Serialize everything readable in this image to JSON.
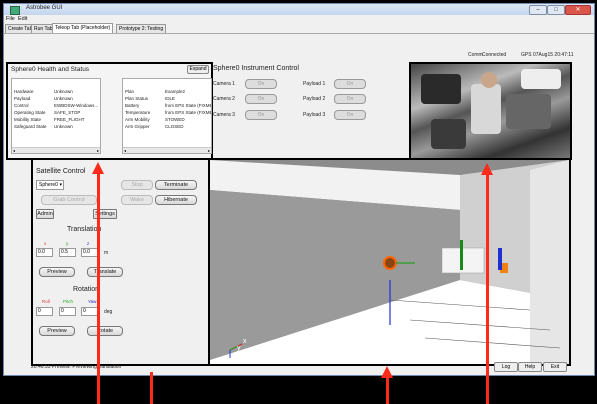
{
  "window": {
    "title": "Astrobee GUI",
    "minimize": "–",
    "maximize": "□",
    "close": "✕"
  },
  "menu": [
    "File",
    "Edit"
  ],
  "tabs": [
    "Create Tab",
    "Run Tab",
    "Teleop Tab (Placeholder)",
    "Prototype 2: Testing"
  ],
  "comm": {
    "label": "Comm",
    "value": "Connected",
    "gps_label": "GPS",
    "gps_value": "07Aug15 20:47:11"
  },
  "health": {
    "title": "Sphere0 Health and Status",
    "expand": "Expand",
    "left_rows": [
      {
        "k": "Hardware",
        "v": "Unknown"
      },
      {
        "k": "Payload",
        "v": "Unknown"
      },
      {
        "k": "Control",
        "v": "EWBDSW-Windows..."
      },
      {
        "k": "Operating State",
        "v": "SAFE_STOP"
      },
      {
        "k": "Mobility State",
        "v": "FREE_FLIGHT"
      },
      {
        "k": "Safeguard State",
        "v": "Unknown"
      }
    ],
    "right_rows": [
      {
        "k": "Plan",
        "v": "Example2"
      },
      {
        "k": "Plan Status",
        "v": "IDLE"
      },
      {
        "k": "Battery",
        "v": "from EPS State (FIXME)"
      },
      {
        "k": "Temperature",
        "v": "from EPS State (FIXME)"
      },
      {
        "k": "Arm Mobility",
        "v": "STOWED"
      },
      {
        "k": "Arm Gripper",
        "v": "CLOSED"
      }
    ],
    "scroll_glyphs": {
      "left": "◂",
      "right": "▸"
    }
  },
  "instrument": {
    "title": "Sphere0 Instrument Control",
    "cameras": [
      "Camera 1",
      "Camera 2",
      "Camera 3"
    ],
    "payloads": [
      "Payload 1",
      "Payload 2",
      "Payload 3"
    ],
    "on_label": "On"
  },
  "satellite": {
    "title": "Satellite Control",
    "select_value": "Sphere0",
    "select_caret": "▾",
    "stop": "Stop",
    "terminate": "Terminate",
    "grab_control": "Grab Control",
    "wake": "Wake",
    "hibernate": "Hibernate",
    "admin": "Admin",
    "settings": "Settings",
    "translation": {
      "title": "Translation",
      "axes": [
        "x",
        "y",
        "z"
      ],
      "values": [
        "0.0",
        "0.5",
        "0.0"
      ],
      "unit": "m",
      "preview": "Preview",
      "action": "Translate"
    },
    "rotation": {
      "title": "Rotation",
      "axes": [
        "Roll",
        "Pitch",
        "Yaw"
      ],
      "values": [
        "0",
        "0",
        "0"
      ],
      "unit": "deg",
      "preview": "Preview",
      "action": "Rotate"
    }
  },
  "view3d": {
    "axis_x": "x",
    "axis_y": "y",
    "axis_z": "z"
  },
  "status_bar": {
    "message": "20:46:55 Preview: Previewing translation"
  },
  "bottom_buttons": [
    "Log",
    "Help",
    "Exit"
  ],
  "colors": {
    "annotation_arrow": "#ff2a1a",
    "x_axis": "#e02020",
    "y_axis": "#20a020",
    "z_axis": "#2030d0"
  }
}
